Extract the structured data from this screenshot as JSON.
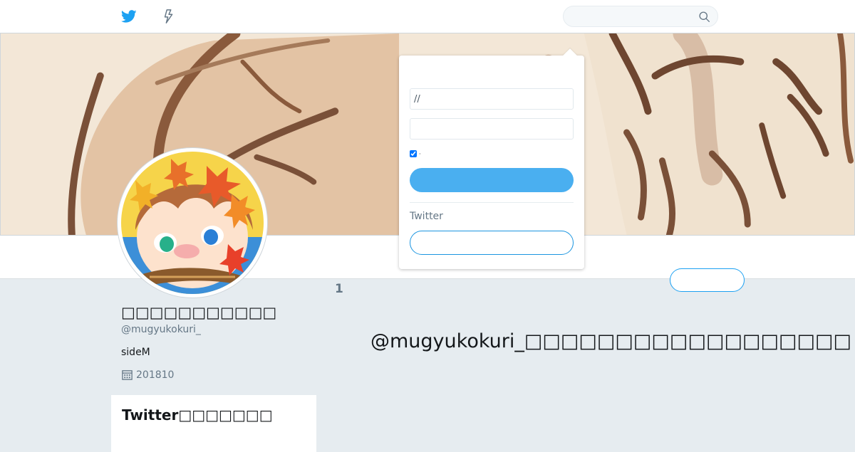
{
  "topbar": {
    "home_icon": "twitter-bird-icon",
    "moments_icon": "lightning-icon",
    "search": {
      "placeholder": "",
      "value": "",
      "icon": "search-icon"
    }
  },
  "login_popover": {
    "username_placeholder": "//",
    "password_placeholder": "",
    "remember_label": "·",
    "login_label": "",
    "prompt": "Twitter",
    "signup_label": ""
  },
  "profile": {
    "name": "□□□□□□□□□□□",
    "handle": "@mugyukokuri_",
    "bio": "sideM",
    "joined": "201810",
    "joined_icon": "calendar-icon",
    "follow_label": "",
    "stat_count": "1"
  },
  "signup_card": {
    "title": "Twitter□□□□□□□"
  },
  "timeline": {
    "empty_message": "@mugyukokuri_□□□□□□□□□□□□□□□□□□"
  },
  "colors": {
    "brand": "#1da1f2",
    "login_button": "#4aaff0",
    "page_background": "#e6ecf0",
    "muted_text": "#657786"
  }
}
